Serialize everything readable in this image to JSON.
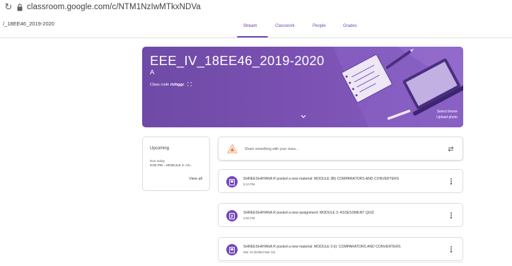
{
  "browser": {
    "url": "classroom.google.com/c/NTM1NzIwMTkxNDVa"
  },
  "header": {
    "breadcrumb": "/_18EE46_2019-2020",
    "tabs": [
      {
        "label": "Stream",
        "active": true
      },
      {
        "label": "Classwork",
        "active": false
      },
      {
        "label": "People",
        "active": false
      },
      {
        "label": "Grades",
        "active": false
      }
    ]
  },
  "banner": {
    "title": "EEE_IV_18EE46_2019-2020",
    "section": "A",
    "class_code_label": "Class code",
    "class_code": "rtzhggc",
    "select_theme": "Select theme",
    "upload_photo": "Upload photo",
    "color": "#7450ad"
  },
  "upcoming": {
    "title": "Upcoming",
    "due": "Due today",
    "item": "9:00 PM – MODULE 3: AS...",
    "view_all": "View all"
  },
  "share": {
    "placeholder": "Share something with your class..."
  },
  "posts": [
    {
      "icon": "material-icon",
      "text": "SHREESHAYANA R posted a new material: MODULE 3B) COMPARATORS AND CONVERTERS",
      "time": "5:10 PM"
    },
    {
      "icon": "assignment-icon",
      "text": "SHREESHAYANA R posted a new assignment: MODULE 3: ASSESSMENT QUIZ",
      "time": "3:05 PM"
    },
    {
      "icon": "material-icon",
      "text": "SHREESHAYANA R posted a new material: MODULE 3 b): COMPARATORS AND CONVERTERS",
      "time": "Mar 19 (Edited Mar 19)"
    }
  ],
  "colors": {
    "accent": "#7248b9",
    "divider": "#dadce0"
  }
}
